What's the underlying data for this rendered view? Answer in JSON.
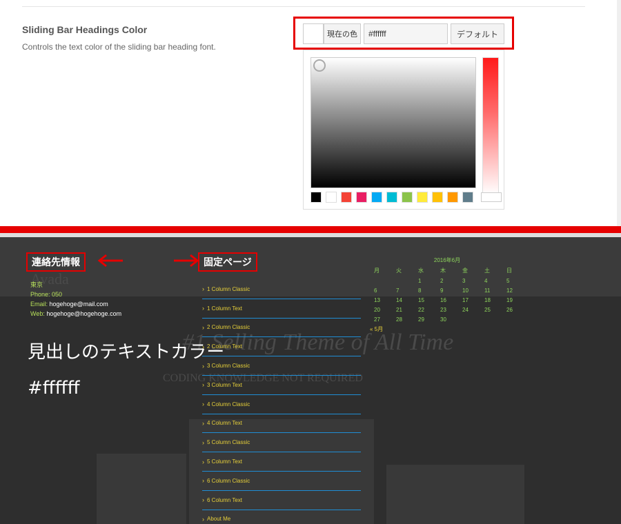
{
  "settings": {
    "title": "Sliding Bar Headings Color",
    "description": "Controls the text color of the sliding bar heading font.",
    "picker": {
      "current_color_label": "現在の色",
      "hex_value": "#ffffff",
      "default_label": "デフォルト",
      "palette": [
        "#000000",
        "#ffffff",
        "#f44336",
        "#e91e63",
        "#03a9f4",
        "#00bcd4",
        "#8bc34a",
        "#ffeb3b",
        "#ffc107",
        "#ff9800",
        "#607d8b"
      ]
    }
  },
  "preview": {
    "contact_heading": "連絡先情報",
    "contact_city": "東京",
    "contact_phone": "Phone: 050",
    "contact_email_label": "Email: ",
    "contact_email": "hogehoge@mail.com",
    "contact_web_label": "Web: ",
    "contact_web": "hogehoge@hogehoge.com",
    "pages_heading": "固定ページ",
    "pages": [
      "1 Column Classic",
      "1 Column Text",
      "2 Column Classic",
      "2 Column Text",
      "3 Column Classic",
      "3 Column Text",
      "4 Column Classic",
      "4 Column Text",
      "5 Column Classic",
      "5 Column Text",
      "6 Column Classic",
      "6 Column Text",
      "About Me"
    ],
    "calendar_title": "2016年6月",
    "calendar_weekdays": [
      "月",
      "火",
      "水",
      "木",
      "金",
      "土",
      "日"
    ],
    "calendar_days": [
      "",
      "",
      "1",
      "2",
      "3",
      "4",
      "5",
      "6",
      "7",
      "8",
      "9",
      "10",
      "11",
      "12",
      "13",
      "14",
      "15",
      "16",
      "17",
      "18",
      "19",
      "20",
      "21",
      "22",
      "23",
      "24",
      "25",
      "26",
      "27",
      "28",
      "29",
      "30",
      "",
      "",
      ""
    ],
    "calendar_prev": "« 5月",
    "ghost_logo": "Avada",
    "ghost_title": "#1 Selling Theme of All Time",
    "ghost_subtitle": "CODING KNOWLEDGE NOT REQUIRED"
  },
  "annotation": {
    "line1": "見出しのテキストカラー",
    "line2": "#ffffff",
    "accent_color": "#e60000"
  }
}
